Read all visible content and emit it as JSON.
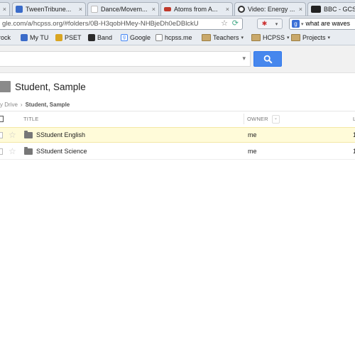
{
  "browser": {
    "tabs": [
      {
        "label": "TweenTribune...",
        "favicon_color": "#3a6bc9"
      },
      {
        "label": "Dance/Movem...",
        "favicon_color": "#cfcfcf"
      },
      {
        "label": "Atoms from A...",
        "favicon_color": "#c0392b"
      },
      {
        "label": "Video: Energy ...",
        "favicon_color": "#333333"
      },
      {
        "label": "BBC - GCSE",
        "favicon_color": "#222222"
      }
    ],
    "address": "gle.com/a/hcpss.org/#folders/0B-H3qobHMey-NHBjeDh0eDBlckU",
    "search_engine_icon": "google-g-icon",
    "search_query": "what are waves"
  },
  "bookmarks": [
    {
      "label": "rock",
      "type": "text"
    },
    {
      "label": "My TU",
      "type": "site",
      "color": "#3a6bc9"
    },
    {
      "label": "PSET",
      "type": "site",
      "color": "#d9a521"
    },
    {
      "label": "Band",
      "type": "site",
      "color": "#2b2b2b"
    },
    {
      "label": "Google",
      "type": "site",
      "color": "#4285f4"
    },
    {
      "label": "hcpss.me",
      "type": "site",
      "color": "#888888"
    },
    {
      "label": "Teachers",
      "type": "folder"
    },
    {
      "label": "HCPSS",
      "type": "folder"
    },
    {
      "label": "Projects",
      "type": "folder"
    }
  ],
  "drive": {
    "search_button_color": "#4787ed",
    "folder_title": "Student, Sample",
    "breadcrumb": {
      "parent": "y Drive",
      "separator": "›",
      "current": "Student, Sample"
    },
    "columns": {
      "title": "TITLE",
      "owner": "OWNER",
      "sort_arrow": "⌄"
    },
    "rows": [
      {
        "name": "SStudent English",
        "owner": "me",
        "selected": true
      },
      {
        "name": "SStudent Science",
        "owner": "me",
        "selected": false
      }
    ]
  }
}
